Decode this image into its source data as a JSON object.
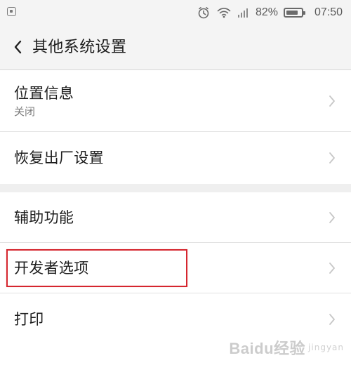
{
  "status_bar": {
    "battery_percent": "82%",
    "time": "07:50",
    "battery_level": 0.82,
    "icons": [
      "app-notification-icon",
      "alarm-icon",
      "wifi-icon",
      "signal-icon",
      "battery-icon"
    ]
  },
  "header": {
    "title": "其他系统设置",
    "back_icon": "chevron-left-icon"
  },
  "settings": {
    "items": [
      {
        "label": "位置信息",
        "subtitle": "关闭",
        "chevron_icon": "chevron-right-icon"
      },
      {
        "label": "恢复出厂设置",
        "chevron_icon": "chevron-right-icon"
      },
      {
        "label": "辅助功能",
        "chevron_icon": "chevron-right-icon"
      },
      {
        "label": "开发者选项",
        "chevron_icon": "chevron-right-icon",
        "highlighted": true
      },
      {
        "label": "打印",
        "chevron_icon": "chevron-right-icon"
      }
    ]
  },
  "watermark": {
    "text": "Baidu经验",
    "subtext": "jingyan"
  },
  "colors": {
    "background": "#f2f2f2",
    "card": "#ffffff",
    "text": "#1f1f1f",
    "secondary_text": "#7b7b7b",
    "divider": "#e2e2e2",
    "highlight": "#d5262f"
  }
}
